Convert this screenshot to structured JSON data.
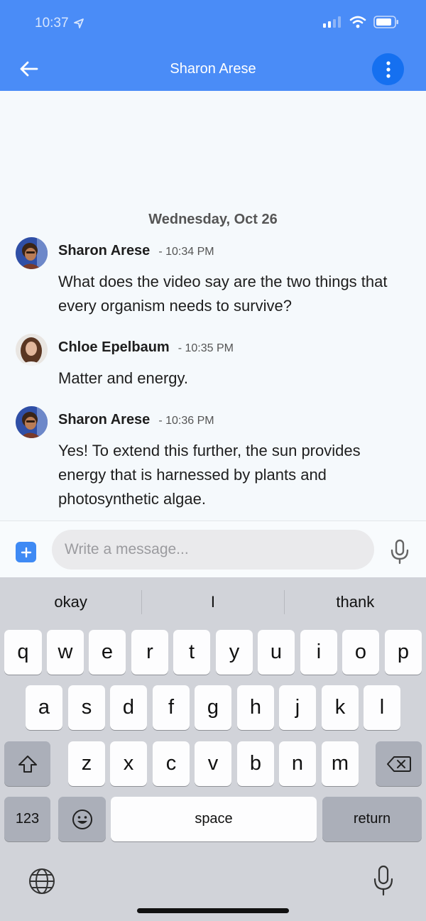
{
  "status_bar": {
    "time": "10:37"
  },
  "header": {
    "title": "Sharon Arese"
  },
  "conversation": {
    "date_separator": "Wednesday, Oct 26",
    "messages": [
      {
        "sender": "Sharon Arese",
        "time": "- 10:34 PM",
        "text": "What does the video say are the two things that every organism needs to survive?"
      },
      {
        "sender": "Chloe Epelbaum",
        "time": "- 10:35 PM",
        "text": "Matter and energy."
      },
      {
        "sender": "Sharon Arese",
        "time": "- 10:36 PM",
        "text": "Yes! To extend this further, the sun provides energy that is harnessed by plants and photosynthetic algae."
      }
    ]
  },
  "composer": {
    "placeholder": "Write a message..."
  },
  "keyboard": {
    "suggestions": [
      "okay",
      "I",
      "thank"
    ],
    "row1": [
      "q",
      "w",
      "e",
      "r",
      "t",
      "y",
      "u",
      "i",
      "o",
      "p"
    ],
    "row2": [
      "a",
      "s",
      "d",
      "f",
      "g",
      "h",
      "j",
      "k",
      "l"
    ],
    "row3": [
      "z",
      "x",
      "c",
      "v",
      "b",
      "n",
      "m"
    ],
    "numbers_key": "123",
    "space_key": "space",
    "return_key": "return"
  },
  "colors": {
    "header_bg": "#4a8cf7",
    "accent": "#1570f0",
    "keyboard_bg": "#d1d3d9"
  }
}
